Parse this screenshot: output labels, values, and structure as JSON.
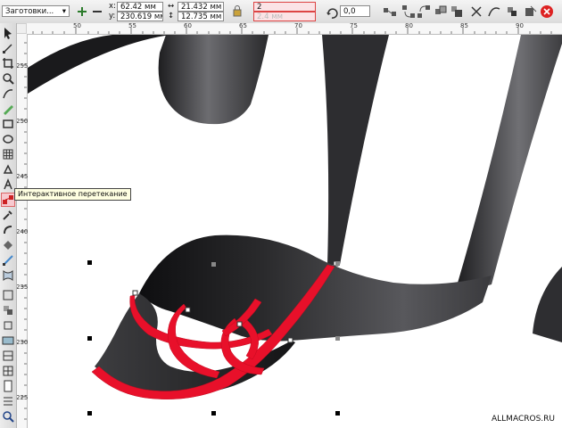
{
  "property_bar": {
    "preset_select": "Заготовки...",
    "x_label": "x:",
    "x_value": "62.42 мм",
    "y_label": "y:",
    "y_value": "230.619 мм",
    "width_value": "21.432 мм",
    "height_value": "12.735 мм",
    "steps_value": "2",
    "offset_value": "2.4 мм",
    "angle_value": "0,0"
  },
  "ruler": {
    "top_ticks": [
      "50",
      "55",
      "60",
      "65",
      "70",
      "75",
      "80",
      "85",
      "90"
    ],
    "left_ticks": [
      "255",
      "250",
      "245",
      "240",
      "235",
      "230",
      "225"
    ]
  },
  "tooltip": "Интерактивное перетекание",
  "watermark": "ALLMACROS.RU",
  "colors": {
    "blend_red": "#e8102a",
    "ribbon_dark": "#2b2b2d",
    "tool_highlight": "#f7c9cf"
  }
}
